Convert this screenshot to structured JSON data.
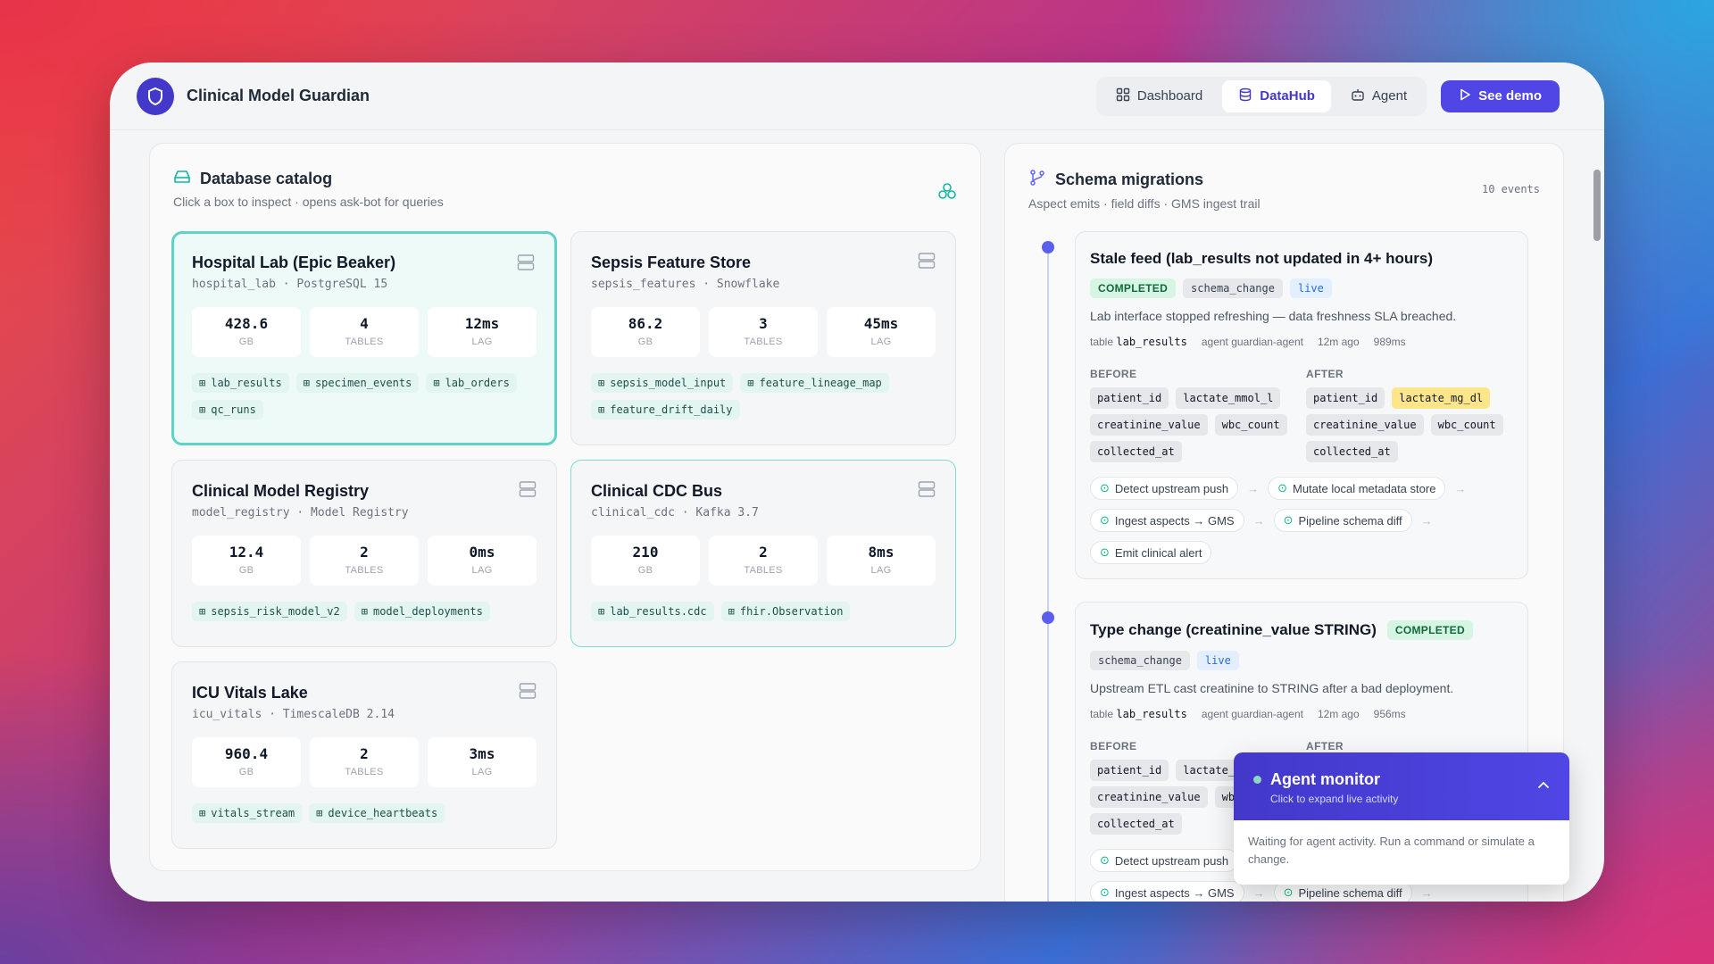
{
  "app": {
    "title": "Clinical Model Guardian",
    "nav": [
      {
        "label": "Dashboard",
        "icon": "grid-icon"
      },
      {
        "label": "DataHub",
        "icon": "database-icon"
      },
      {
        "label": "Agent",
        "icon": "robot-icon"
      }
    ],
    "active_nav": "DataHub",
    "demo_label": "See demo",
    "accent": "#4f46e5"
  },
  "catalog": {
    "title": "Database catalog",
    "subtitle": "Click a box to inspect · opens ask-bot for queries",
    "databases": [
      {
        "name": "Hospital Lab (Epic Beaker)",
        "meta": "hospital_lab · PostgreSQL 15",
        "stats": [
          {
            "value": "428.6",
            "label": "GB"
          },
          {
            "value": "4",
            "label": "TABLES"
          },
          {
            "value": "12ms",
            "label": "LAG"
          }
        ],
        "tables": [
          "lab_results",
          "specimen_events",
          "lab_orders",
          "qc_runs"
        ]
      },
      {
        "name": "Sepsis Feature Store",
        "meta": "sepsis_features · Snowflake",
        "stats": [
          {
            "value": "86.2",
            "label": "GB"
          },
          {
            "value": "3",
            "label": "TABLES"
          },
          {
            "value": "45ms",
            "label": "LAG"
          }
        ],
        "tables": [
          "sepsis_model_input",
          "feature_lineage_map",
          "feature_drift_daily"
        ]
      },
      {
        "name": "Clinical Model Registry",
        "meta": "model_registry · Model Registry",
        "stats": [
          {
            "value": "12.4",
            "label": "GB"
          },
          {
            "value": "2",
            "label": "TABLES"
          },
          {
            "value": "0ms",
            "label": "LAG"
          }
        ],
        "tables": [
          "sepsis_risk_model_v2",
          "model_deployments"
        ]
      },
      {
        "name": "Clinical CDC Bus",
        "meta": "clinical_cdc · Kafka 3.7",
        "stats": [
          {
            "value": "210",
            "label": "GB"
          },
          {
            "value": "2",
            "label": "TABLES"
          },
          {
            "value": "8ms",
            "label": "LAG"
          }
        ],
        "tables": [
          "lab_results.cdc",
          "fhir.Observation"
        ]
      },
      {
        "name": "ICU Vitals Lake",
        "meta": "icu_vitals · TimescaleDB 2.14",
        "stats": [
          {
            "value": "960.4",
            "label": "GB"
          },
          {
            "value": "2",
            "label": "TABLES"
          },
          {
            "value": "3ms",
            "label": "LAG"
          }
        ],
        "tables": [
          "vitals_stream",
          "device_heartbeats"
        ]
      }
    ]
  },
  "migrations": {
    "title": "Schema migrations",
    "subtitle": "Aspect emits · field diffs · GMS ingest trail",
    "count": "10 events",
    "events": [
      {
        "title": "Stale feed (lab_results not updated in 4+ hours)",
        "status": "COMPLETED",
        "kind": "schema_change",
        "mode": "live",
        "desc": "Lab interface stopped refreshing — data freshness SLA breached.",
        "table_label": "table",
        "table": "lab_results",
        "agent": "agent guardian-agent",
        "ago": "12m ago",
        "duration": "989ms",
        "before_label": "BEFORE",
        "after_label": "AFTER",
        "before": [
          "patient_id",
          "lactate_mmol_l",
          "creatinine_value",
          "wbc_count",
          "collected_at"
        ],
        "after": [
          "patient_id",
          "lactate_mg_dl",
          "creatinine_value",
          "wbc_count",
          "collected_at"
        ],
        "steps": [
          "Detect upstream push",
          "Mutate local metadata store",
          "Ingest aspects → GMS",
          "Pipeline schema diff",
          "Emit clinical alert"
        ]
      },
      {
        "title": "Type change (creatinine_value STRING)",
        "status": "COMPLETED",
        "kind": "schema_change",
        "mode": "live",
        "desc": "Upstream ETL cast creatinine to STRING after a bad deployment.",
        "table_label": "table",
        "table": "lab_results",
        "agent": "agent guardian-agent",
        "ago": "12m ago",
        "duration": "956ms",
        "before_label": "BEFORE",
        "after_label": "AFTER",
        "before": [
          "patient_id",
          "lactate_",
          "creatinine_value",
          "wbc",
          "collected_at"
        ],
        "steps": [
          "Detect upstream push",
          "Ingest aspects → GMS",
          "Pipeline schema diff"
        ]
      }
    ]
  },
  "monitor": {
    "title": "Agent monitor",
    "subtitle": "Click to expand live activity",
    "body": "Waiting for agent activity. Run a command or simulate a change."
  }
}
